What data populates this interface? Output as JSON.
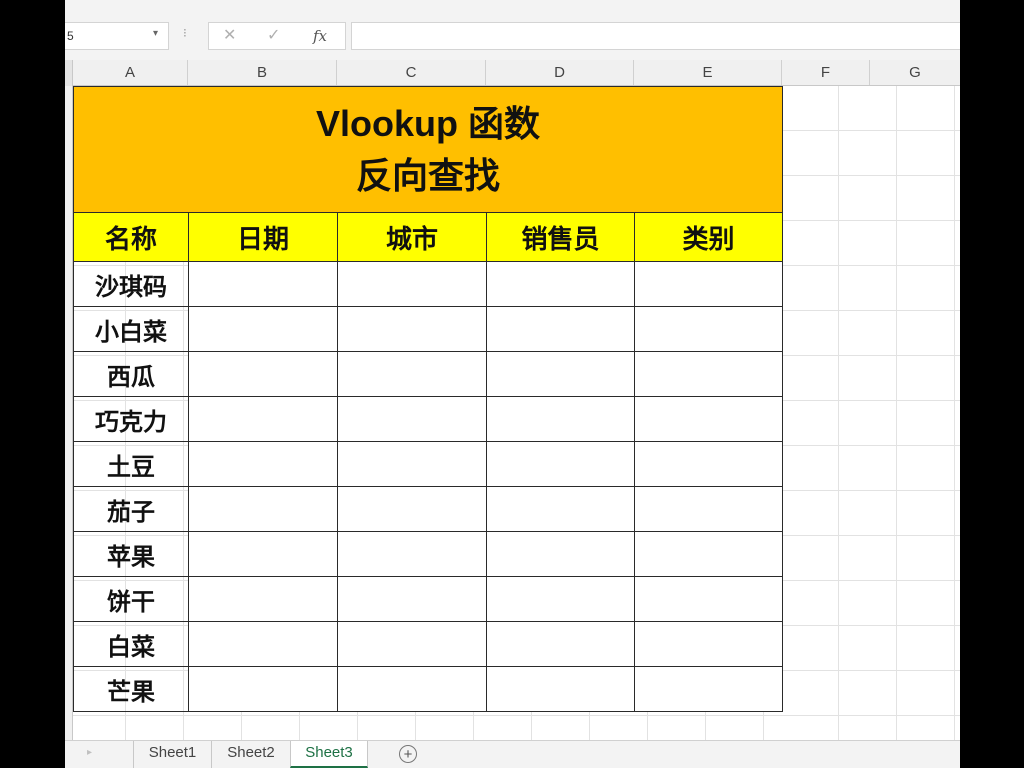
{
  "formula_bar": {
    "name_box_value": "5",
    "cancel_glyph": "✕",
    "enter_glyph": "✓",
    "fx_label": "fx",
    "formula_value": ""
  },
  "columns": [
    "A",
    "B",
    "C",
    "D",
    "E",
    "F",
    "G"
  ],
  "sheet": {
    "title_line1": "Vlookup 函数",
    "title_line2": "反向查找",
    "headers": [
      "名称",
      "日期",
      "城市",
      "销售员",
      "类别"
    ],
    "names": [
      "沙琪码",
      "小白菜",
      "西瓜",
      "巧克力",
      "土豆",
      "茄子",
      "苹果",
      "饼干",
      "白菜",
      "芒果"
    ]
  },
  "colors": {
    "title_fill": "#ffbf00",
    "header_fill": "#ffff00",
    "active_tab": "#1e7145"
  },
  "tabs": {
    "items": [
      "Sheet1",
      "Sheet2",
      "Sheet3"
    ],
    "active": "Sheet3",
    "add_glyph": "+"
  }
}
